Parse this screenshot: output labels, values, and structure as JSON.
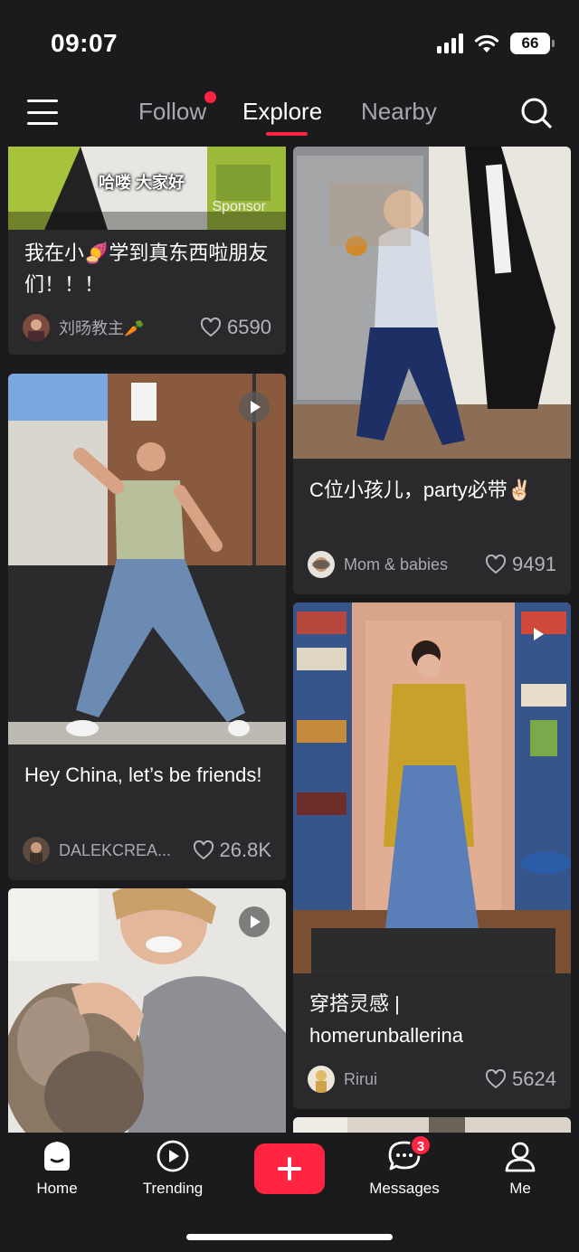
{
  "status_bar": {
    "time": "09:07",
    "battery": "66"
  },
  "top_nav": {
    "tabs": [
      {
        "label": "Follow",
        "active": false,
        "has_dot": true
      },
      {
        "label": "Explore",
        "active": true
      },
      {
        "label": "Nearby",
        "active": false
      }
    ],
    "accent_color": "#ff2442"
  },
  "feed": {
    "cards": [
      {
        "title": "我在小🍠学到真东西啦朋友们！！！",
        "author": "刘旸教主🥕",
        "likes": "6590",
        "overlay_text": "哈喽 大家好",
        "tag": "Sponsor"
      },
      {
        "title": "C位小孩儿，party必带✌🏻",
        "author": "Mom & babies",
        "likes": "9491"
      },
      {
        "title": "Hey China, let’s be friends!",
        "author": "DALEKCREA...",
        "likes": "26.8K",
        "video": true
      },
      {
        "title": "穿搭灵感 | homerunballerina",
        "author": "Rirui",
        "likes": "5624",
        "video": true
      },
      {
        "video": true
      }
    ]
  },
  "bottom_nav": {
    "items": [
      {
        "label": "Home",
        "icon": "home-icon"
      },
      {
        "label": "Trending",
        "icon": "play-circle-icon"
      },
      {
        "label": "Messages",
        "icon": "chat-bubble-icon",
        "badge": "3"
      },
      {
        "label": "Me",
        "icon": "person-icon"
      }
    ],
    "post_icon": "plus-icon"
  }
}
